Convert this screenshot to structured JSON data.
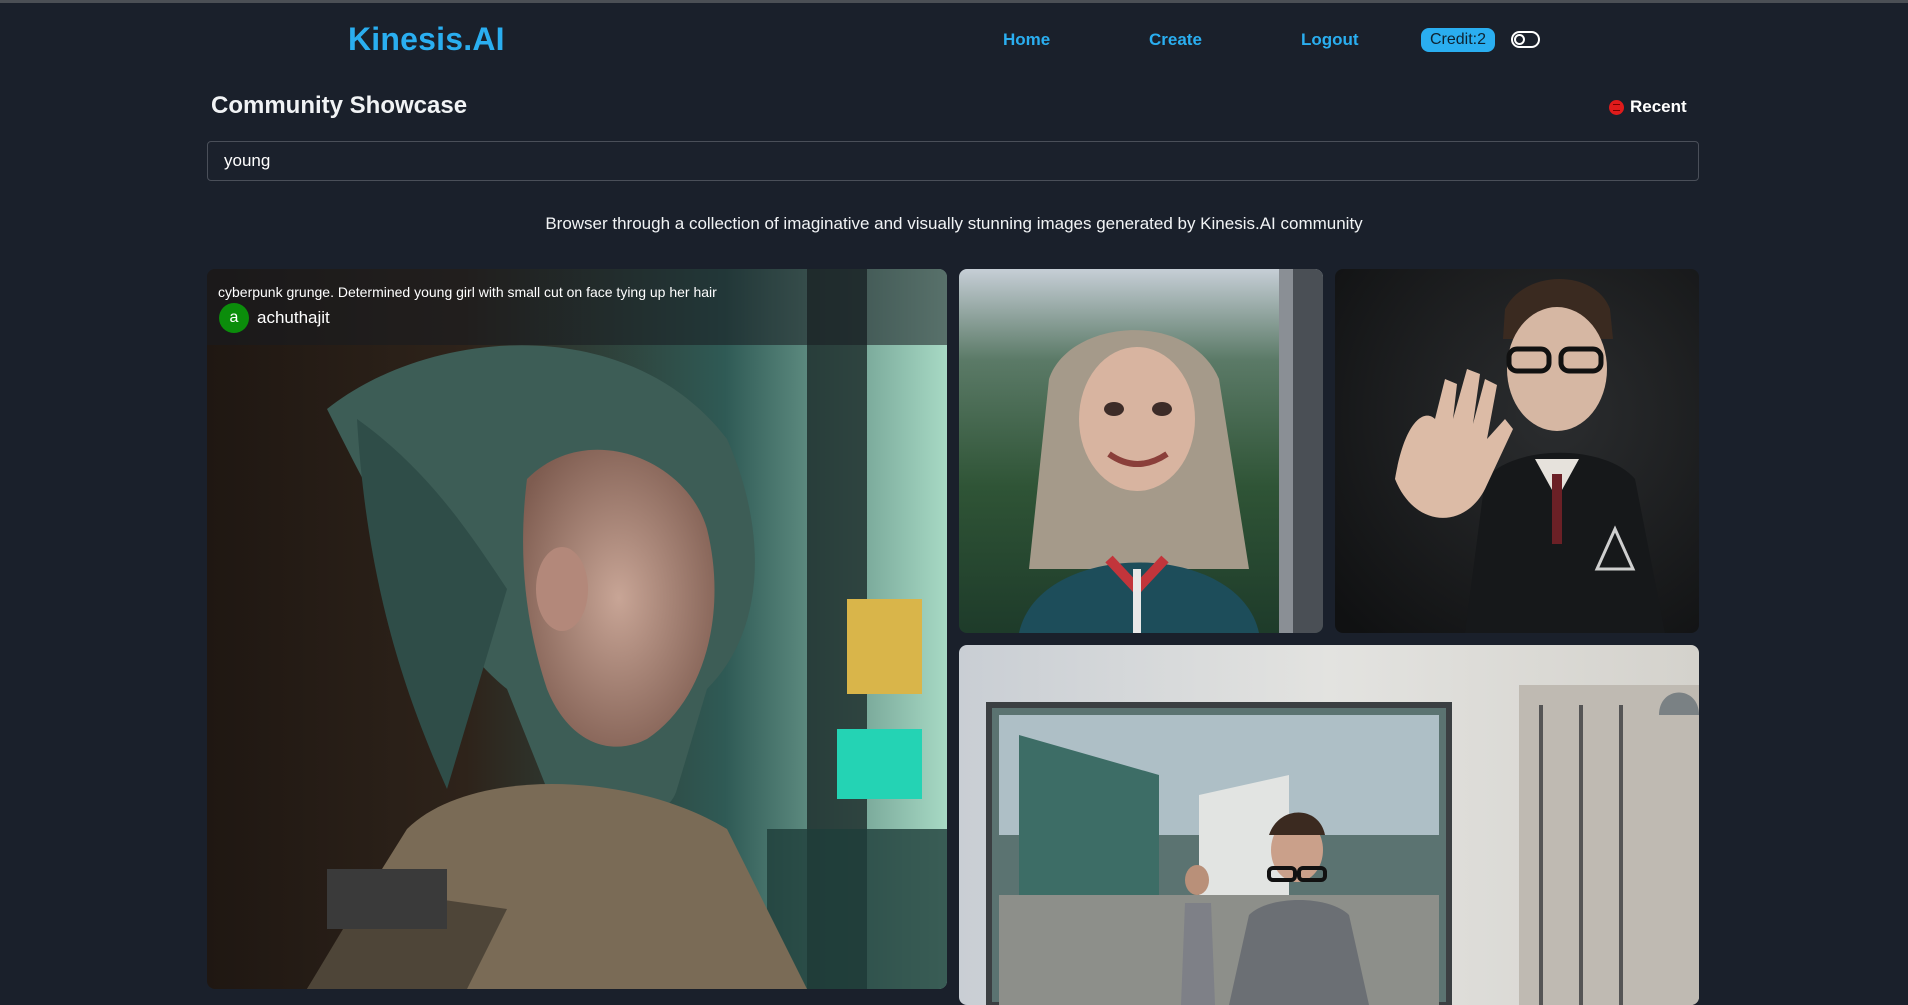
{
  "brand": {
    "name": "Kinesis.AI"
  },
  "nav": {
    "home": "Home",
    "create": "Create",
    "logout": "Logout",
    "credit": "Credit:2"
  },
  "theme_toggle": {
    "icon": "toggle-icon"
  },
  "showcase": {
    "title": "Community Showcase",
    "recent_label": "Recent",
    "recent_icon": "recent-icon"
  },
  "search": {
    "value": "young"
  },
  "description": "Browser through a collection of imaginative and visually stunning images generated by Kinesis.AI community",
  "colors": {
    "accent": "#2aaef0",
    "background": "#1a202b",
    "avatar": "#0b8d0b",
    "recent_dot": "#e01b1b"
  },
  "gallery": {
    "items": [
      {
        "prompt": "cyberpunk grunge. Determined young girl with small cut on face tying up her hair",
        "author_initial": "a",
        "author": "achuthajit",
        "download_icon": "download-icon"
      }
    ]
  }
}
